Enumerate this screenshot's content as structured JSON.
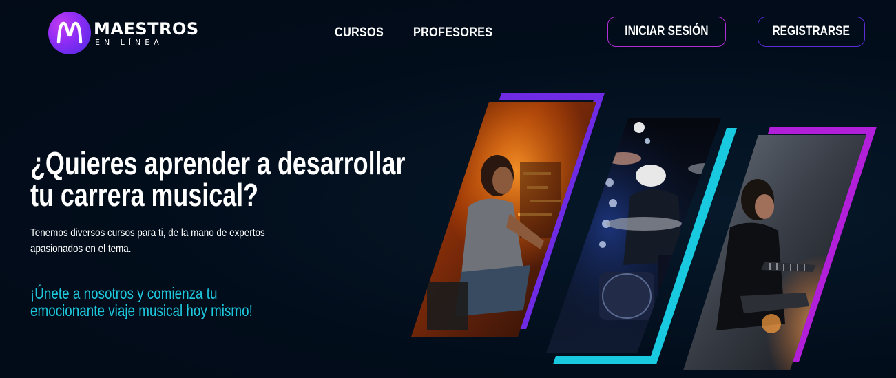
{
  "brand": {
    "name": "MAESTROS",
    "tagline": "EN LÍNEA"
  },
  "nav": {
    "items": [
      {
        "label": "CURSOS"
      },
      {
        "label": "PROFESORES"
      }
    ]
  },
  "header": {
    "login_label": "INICIAR SESIÓN",
    "register_label": "REGISTRARSE"
  },
  "hero": {
    "title_line1": "¿Quieres aprender a desarrollar",
    "title_line2": "tu carrera musical?",
    "description": "Tenemos diversos cursos para ti, de la mano de expertos apasionados en el tema.",
    "cta": "¡Únete a nosotros y comienza tu emocionante viaje musical hoy mismo!"
  },
  "colors": {
    "background": "#020d1b",
    "accent_cyan": "#1ec8dd",
    "accent_purple": "#7b2ee6",
    "accent_magenta": "#b61fd6"
  }
}
